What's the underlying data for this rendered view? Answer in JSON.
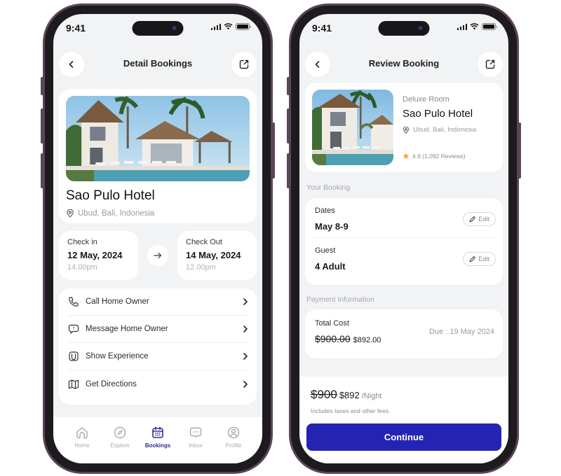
{
  "status_bar": {
    "time": "9:41"
  },
  "detail_screen": {
    "title": "Detail Bookings",
    "hotel": {
      "name": "Sao Pulo Hotel",
      "location": "Ubud, Bali, Indonesia",
      "photo": "hotel-villa-pool-photo"
    },
    "check_in": {
      "label": "Check in",
      "date": "12 May, 2024",
      "time": "14.00pm"
    },
    "check_out": {
      "label": "Check Out",
      "date": "14 May, 2024",
      "time": "12.00pm"
    },
    "actions": [
      {
        "label": "Call Home Owner",
        "icon": "phone-icon"
      },
      {
        "label": "Message Home Owner",
        "icon": "message-question-icon"
      },
      {
        "label": "Show Experience",
        "icon": "experience-icon"
      },
      {
        "label": "Get Directions",
        "icon": "map-icon"
      }
    ],
    "tabs": [
      {
        "label": "Home",
        "icon": "home-icon",
        "active": false
      },
      {
        "label": "Explore",
        "icon": "compass-icon",
        "active": false
      },
      {
        "label": "Bookings",
        "icon": "calendar-icon",
        "active": true
      },
      {
        "label": "Inbox",
        "icon": "chat-icon",
        "active": false
      },
      {
        "label": "Profile",
        "icon": "profile-icon",
        "active": false
      }
    ]
  },
  "review_screen": {
    "title": "Review Booking",
    "room": {
      "type": "Deluxe Room",
      "hotel_name": "Sao Pulo Hotel",
      "location": "Ubud, Bali, Indonesia",
      "rating": "4.9 (1,092 Reviews)"
    },
    "your_booking_label": "Your Booking",
    "booking": [
      {
        "label": "Dates",
        "value": "May 8-9",
        "edit_label": "Edit"
      },
      {
        "label": "Guest",
        "value": "4 Adult",
        "edit_label": "Edit"
      }
    ],
    "payment_label": "Payment Information",
    "payment": {
      "label": "Total Cost",
      "original_price": "$900.00",
      "discounted_price": "$892.00",
      "due": "Due : 19 May 2024"
    },
    "summary": {
      "original_per_night": "$900",
      "price_per_night": "$892",
      "unit": "/Night",
      "note": "Includes taxes and other fees."
    },
    "continue_label": "Continue"
  },
  "colors": {
    "accent": "#2424b4",
    "active_tab": "#2f2f8f",
    "screen_bg": "#f2f3f5",
    "frame": "#5b4557",
    "star": "#f5a623"
  }
}
